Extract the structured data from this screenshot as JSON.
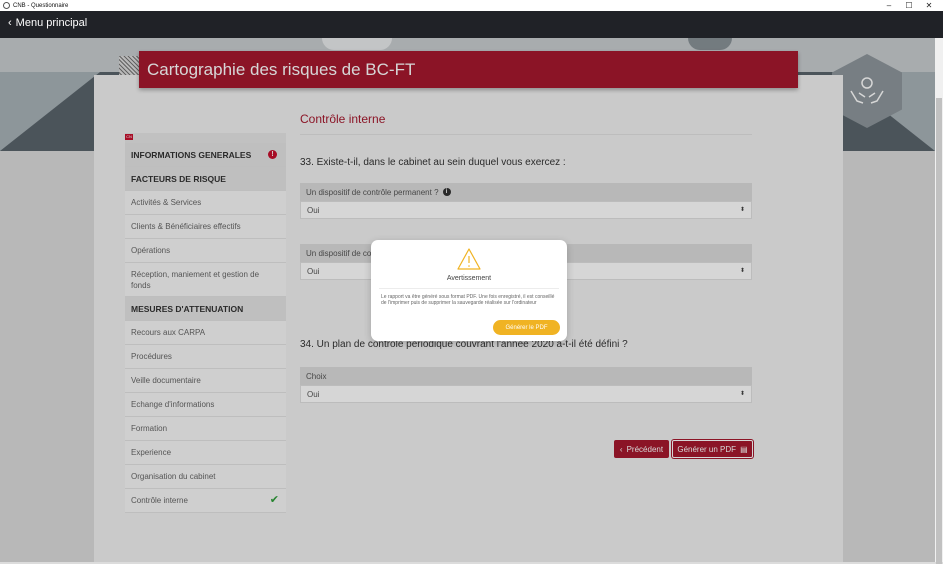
{
  "window": {
    "title": "CNB - Questionnaire",
    "controls": [
      "–",
      "☐",
      "✕"
    ]
  },
  "nav": {
    "back_label": "Menu principal"
  },
  "banner": {
    "title": "Cartographie des risques de BC-FT"
  },
  "sidebar": {
    "flag": "CN",
    "items": [
      {
        "label": "INFORMATIONS GENERALES",
        "type": "header",
        "status": "error"
      },
      {
        "label": "FACTEURS DE RISQUE",
        "type": "header"
      },
      {
        "label": "Activités & Services",
        "type": "item"
      },
      {
        "label": "Clients & Bénéficiaires effectifs",
        "type": "item"
      },
      {
        "label": "Opérations",
        "type": "item"
      },
      {
        "label": "Réception, maniement et gestion de fonds",
        "type": "item",
        "tall": true
      },
      {
        "label": "MESURES D'ATTENUATION",
        "type": "header"
      },
      {
        "label": "Recours aux CARPA",
        "type": "item"
      },
      {
        "label": "Procédures",
        "type": "item"
      },
      {
        "label": "Veille documentaire",
        "type": "item"
      },
      {
        "label": "Echange d'informations",
        "type": "item"
      },
      {
        "label": "Formation",
        "type": "item"
      },
      {
        "label": "Experience",
        "type": "item"
      },
      {
        "label": "Organisation du cabinet",
        "type": "item"
      },
      {
        "label": "Contrôle interne",
        "type": "item",
        "status": "done"
      }
    ]
  },
  "content": {
    "section_title": "Contrôle interne",
    "q33": "33. Existe-t-il, dans le cabinet au sein duquel vous exercez :",
    "field1": {
      "label": "Un dispositif de contrôle permanent ?",
      "value": "Oui"
    },
    "field2": {
      "label": "Un dispositif de co",
      "value": "Oui"
    },
    "q34": "34. Un plan de contrôle périodique couvrant l'année 2020 a-t-il été défini ?",
    "field3": {
      "label": "Choix",
      "value": "Oui"
    },
    "prev_button": "Précédent",
    "pdf_button": "Générer un PDF"
  },
  "modal": {
    "title": "Avertissement",
    "text": "Le rapport va être généré sous format PDF. Une fois enregistré, il est conseillé de l'imprimer puis de supprimer la sauvegarde réalisée sur l'ordinateur",
    "button": "Générer le PDF"
  },
  "colors": {
    "brand_red": "#a6192e",
    "warning_yellow": "#f0b323",
    "nav_dark": "#202227",
    "success_green": "#2e9e3a"
  }
}
